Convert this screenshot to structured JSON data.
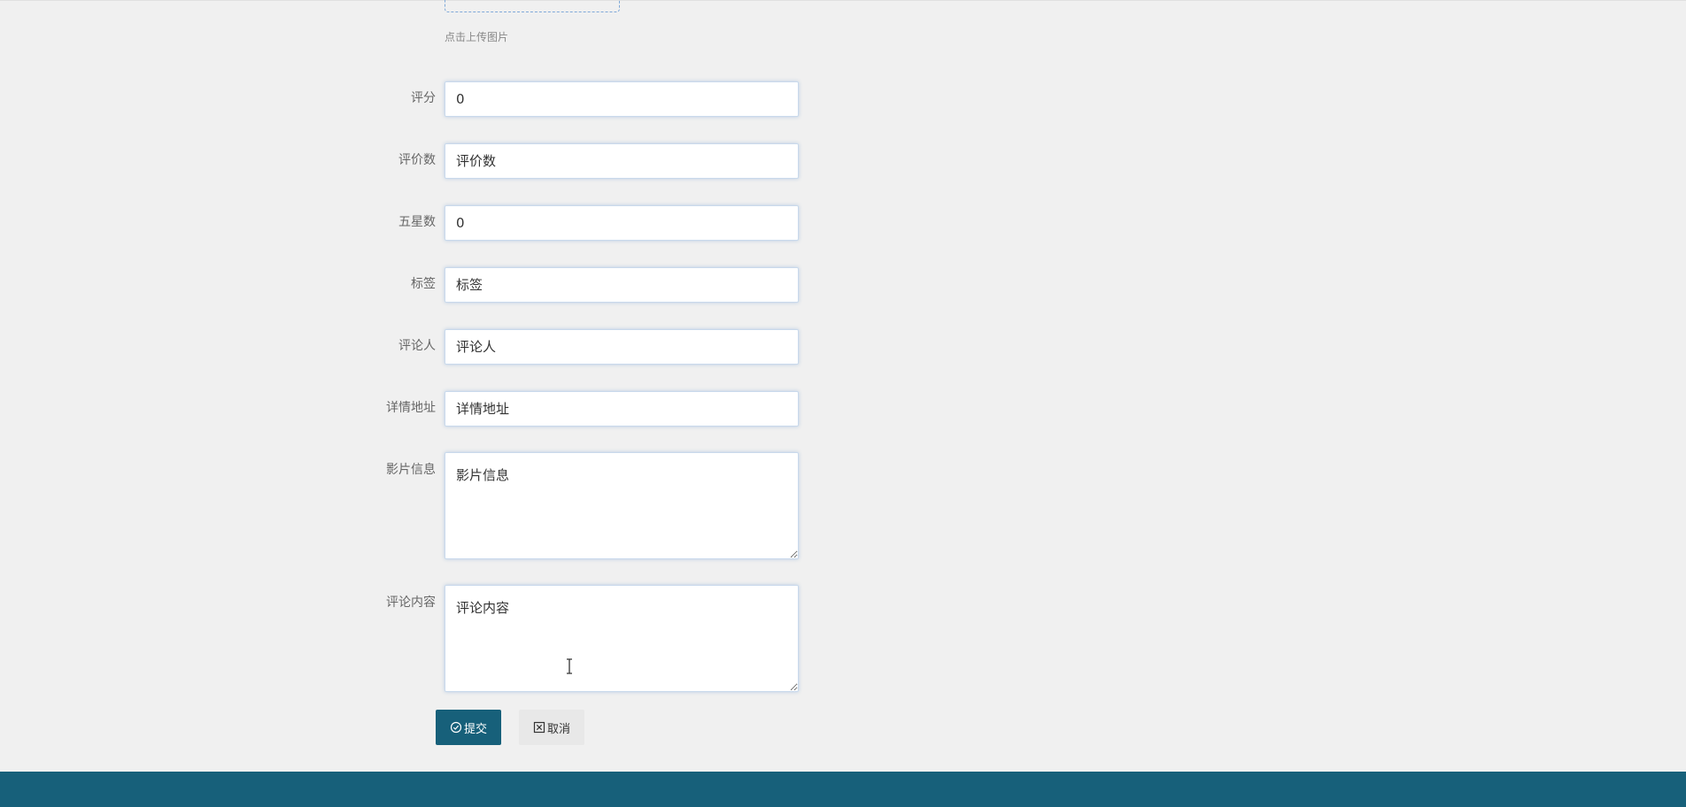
{
  "upload": {
    "hint": "点击上传图片"
  },
  "fields": {
    "score": {
      "label": "评分",
      "value": "0",
      "placeholder": ""
    },
    "review_count": {
      "label": "评价数",
      "value": "",
      "placeholder": "评价数"
    },
    "five_star": {
      "label": "五星数",
      "value": "0",
      "placeholder": ""
    },
    "tags": {
      "label": "标签",
      "value": "",
      "placeholder": "标签"
    },
    "reviewer": {
      "label": "评论人",
      "value": "",
      "placeholder": "评论人"
    },
    "detail_url": {
      "label": "详情地址",
      "value": "",
      "placeholder": "详情地址"
    },
    "movie_info": {
      "label": "影片信息",
      "value": "",
      "placeholder": "影片信息"
    },
    "comment": {
      "label": "评论内容",
      "value": "",
      "placeholder": "评论内容"
    }
  },
  "actions": {
    "submit_label": "提交",
    "cancel_label": "取消"
  },
  "icons": {
    "submit": "check-circle-icon",
    "cancel": "close-square-icon"
  },
  "colors": {
    "primary": "#17607a",
    "background": "#f0f0f0",
    "cancel_bg": "#e8e8e8"
  }
}
